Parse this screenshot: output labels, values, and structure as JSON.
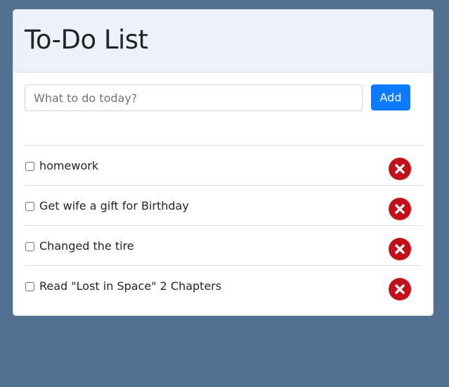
{
  "app": {
    "title": "To-Do List"
  },
  "add_form": {
    "input_value": "",
    "placeholder": "What to do today?",
    "add_label": "Add"
  },
  "todos": [
    {
      "text": "homework",
      "checked": false
    },
    {
      "text": "Get wife a gift for Birthday",
      "checked": false
    },
    {
      "text": "Changed the tire",
      "checked": false
    },
    {
      "text": "Read \"Lost in Space\" 2 Chapters",
      "checked": false
    }
  ],
  "icons": {
    "delete": "close-circle-icon"
  },
  "colors": {
    "background": "#52708f",
    "header_bg": "#eef1fa",
    "primary": "#0d7bff",
    "danger": "#c4101b"
  }
}
